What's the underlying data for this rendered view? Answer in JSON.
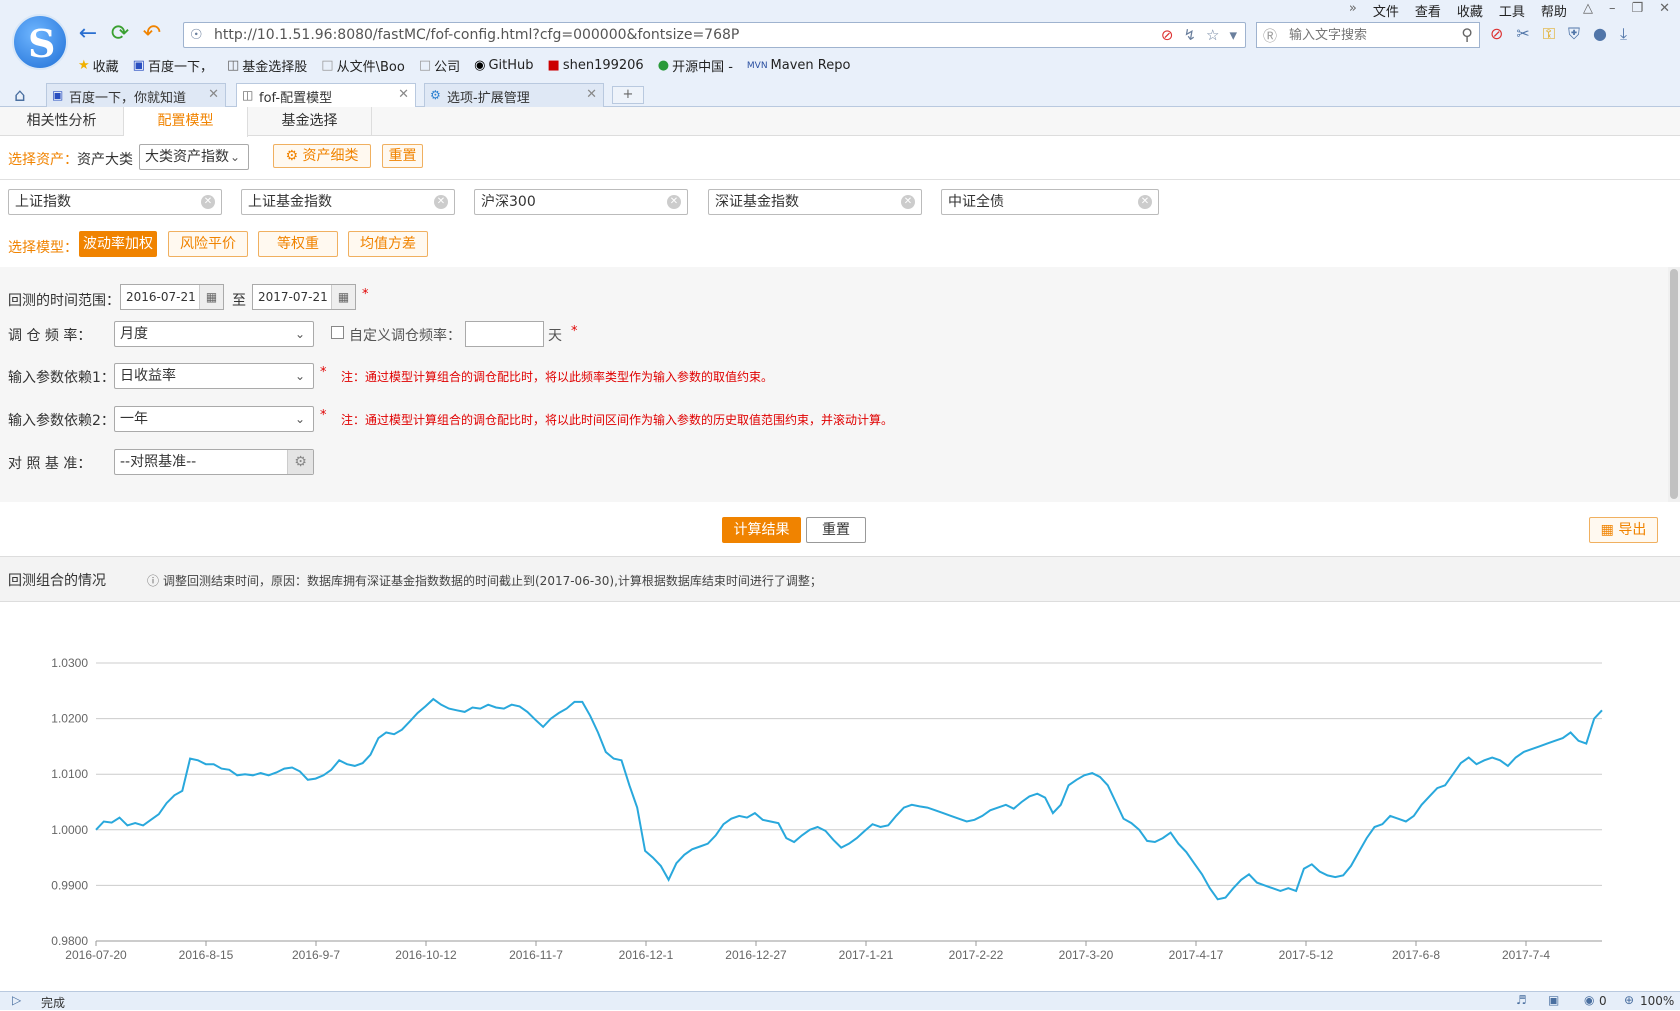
{
  "browser": {
    "menu": [
      "文件",
      "查看",
      "收藏",
      "工具",
      "帮助"
    ],
    "url": "http://10.1.51.96:8080/fastMC/fof-config.html?cfg=000000&fontsize=768P",
    "search_placeholder": "输入文字搜索",
    "bookmarks": [
      "收藏",
      "百度一下，",
      "基金选择股",
      "从文件\\Boo",
      "公司",
      "GitHub",
      "shen199206",
      "开源中国 -",
      "Maven Repo"
    ],
    "tabs": [
      "百度一下，你就知道",
      "fof-配置模型",
      "选项-扩展管理"
    ],
    "status": "完成",
    "zoom": "100%",
    "blocked_count": "0"
  },
  "subtabs": [
    "相关性分析",
    "配置模型",
    "基金选择"
  ],
  "asset_select": {
    "label": "选择资产：",
    "category_label": "资产大类",
    "category_value": "大类资产指数",
    "detail_button": "资产细类",
    "reset_button": "重置"
  },
  "assets": [
    "上证指数",
    "上证基金指数",
    "沪深300",
    "深证基金指数",
    "中证全债"
  ],
  "model_select": {
    "label": "选择模型：",
    "models": [
      "波动率加权",
      "风险平价",
      "等权重",
      "均值方差"
    ]
  },
  "form": {
    "range_label": "回测的时间范围：",
    "start_date": "2016-07-21",
    "to": "至",
    "end_date": "2017-07-21",
    "freq_label": "调 仓 频 率：",
    "freq_value": "月度",
    "custom_freq_label": "自定义调仓频率：",
    "custom_freq_unit": "天",
    "param1_label": "输入参数依赖1：",
    "param1_value": "日收益率",
    "param1_note": "注：通过模型计算组合的调仓配比时，将以此频率类型作为输入参数的取值约束。",
    "param2_label": "输入参数依赖2：",
    "param2_value": "一年",
    "param2_note": "注：通过模型计算组合的调仓配比时，将以此时间区间作为输入参数的历史取值范围约束，并滚动计算。",
    "bench_label": "对 照 基 准：",
    "bench_value": "--对照基准--",
    "required_mark": "*"
  },
  "actions": {
    "calc": "计算结果",
    "reset": "重置",
    "export": "导出"
  },
  "result": {
    "title": "回测组合的情况",
    "notice": "调整回测结束时间，原因：数据库拥有深证基金指数数据的时间截止到(2017-06-30),计算根据数据库结束时间进行了调整；"
  },
  "colors": {
    "accent": "#f08300",
    "line": "#29a8dc",
    "required": "#e00000"
  },
  "chart_data": {
    "type": "line",
    "ylim": [
      0.98,
      1.03
    ],
    "y_ticks": [
      "1.0300",
      "1.0200",
      "1.0100",
      "1.0000",
      "0.9900",
      "0.9800"
    ],
    "x_ticks": [
      "2016-07-20",
      "2016-8-15",
      "2016-9-7",
      "2016-10-12",
      "2016-11-7",
      "2016-12-1",
      "2016-12-27",
      "2017-1-21",
      "2017-2-22",
      "2017-3-20",
      "2017-4-17",
      "2017-5-12",
      "2017-6-8",
      "2017-7-4"
    ],
    "grid": true,
    "series": [
      {
        "values": [
          1.0,
          1.0015,
          1.0013,
          1.0022,
          1.0008,
          1.0012,
          1.0008,
          1.0018,
          1.0028,
          1.0048,
          1.0062,
          1.007,
          1.0128,
          1.0125,
          1.0118,
          1.0118,
          1.011,
          1.0108,
          1.0098,
          1.01,
          1.0098,
          1.0102,
          1.0098,
          1.0103,
          1.011,
          1.0112,
          1.0105,
          1.009,
          1.0092,
          1.0098,
          1.0108,
          1.0125,
          1.0118,
          1.0115,
          1.012,
          1.0135,
          1.0165,
          1.0175,
          1.0172,
          1.018,
          1.0195,
          1.021,
          1.0222,
          1.0235,
          1.0225,
          1.0218,
          1.0215,
          1.0212,
          1.022,
          1.0218,
          1.0225,
          1.022,
          1.0218,
          1.0225,
          1.0222,
          1.0212,
          1.0198,
          1.0185,
          1.02,
          1.021,
          1.0218,
          1.023,
          1.023,
          1.0205,
          1.0175,
          1.014,
          1.0128,
          1.0125,
          1.008,
          1.004,
          0.9962,
          0.995,
          0.9935,
          0.991,
          0.994,
          0.9955,
          0.9965,
          0.997,
          0.9975,
          0.999,
          1.001,
          1.002,
          1.0025,
          1.0022,
          1.003,
          1.0018,
          1.0015,
          1.0012,
          0.9985,
          0.9978,
          0.999,
          1.0,
          1.0005,
          0.9998,
          0.9982,
          0.9968,
          0.9975,
          0.9985,
          0.9998,
          1.001,
          1.0005,
          1.0008,
          1.0025,
          1.004,
          1.0045,
          1.0042,
          1.004,
          1.0035,
          1.003,
          1.0025,
          1.002,
          1.0015,
          1.0018,
          1.0025,
          1.0035,
          1.004,
          1.0045,
          1.0038,
          1.005,
          1.006,
          1.0065,
          1.0058,
          1.003,
          1.0045,
          1.008,
          1.009,
          1.0098,
          1.0102,
          1.0095,
          1.008,
          1.005,
          1.002,
          1.0012,
          1.0,
          0.998,
          0.9978,
          0.9985,
          0.9995,
          0.9975,
          0.996,
          0.994,
          0.992,
          0.9895,
          0.9875,
          0.9878,
          0.9895,
          0.991,
          0.992,
          0.9905,
          0.99,
          0.9895,
          0.989,
          0.9895,
          0.989,
          0.993,
          0.9938,
          0.9925,
          0.9918,
          0.9915,
          0.9918,
          0.9935,
          0.996,
          0.9985,
          1.0005,
          1.001,
          1.0025,
          1.002,
          1.0015,
          1.0025,
          1.0045,
          1.006,
          1.0075,
          1.008,
          1.01,
          1.012,
          1.013,
          1.0118,
          1.0125,
          1.013,
          1.0125,
          1.0115,
          1.013,
          1.014,
          1.0145,
          1.015,
          1.0155,
          1.016,
          1.0165,
          1.0175,
          1.016,
          1.0155,
          1.02,
          1.0215
        ]
      }
    ]
  }
}
